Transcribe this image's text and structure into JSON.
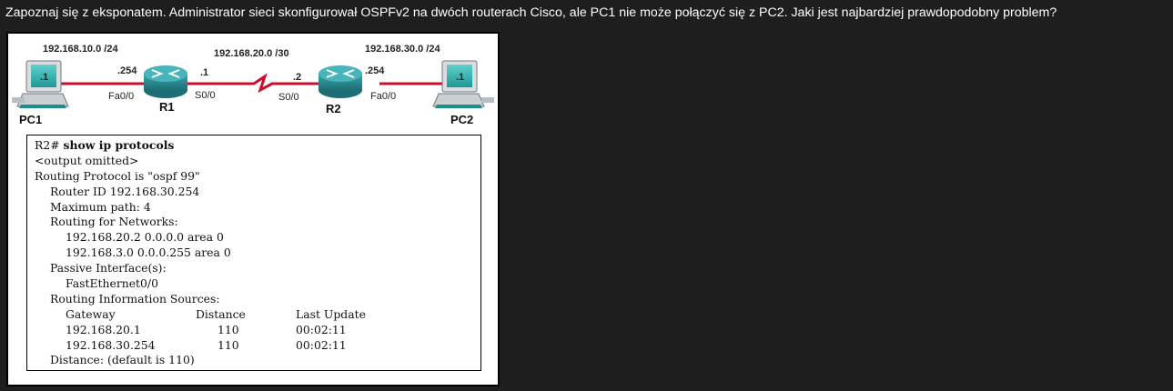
{
  "question": "Zapoznaj się z eksponatem. Administrator sieci skonfigurował OSPFv2 na dwóch routerach Cisco, ale PC1 nie może połączyć się z PC2. Jaki jest najbardziej prawdopodobny problem?",
  "topology": {
    "net_left": "192.168.10.0 /24",
    "net_mid": "192.168.20.0 /30",
    "net_right": "192.168.30.0 /24",
    "pc1_ip_label": ".1",
    "pc2_ip_label": ".1",
    "r1_fa_ip": ".254",
    "r1_s_ip": ".1",
    "r2_s_ip": ".2",
    "r2_fa_ip": ".254",
    "r1_fa_if": "Fa0/0",
    "r1_s_if": "S0/0",
    "r2_s_if": "S0/0",
    "r2_fa_if": "Fa0/0",
    "pc1": "PC1",
    "pc2": "PC2",
    "r1": "R1",
    "r2": "R2",
    "colors": {
      "router": "#2b8f95",
      "link": "#c8102e",
      "pc_screen": "#29a9a6"
    }
  },
  "terminal": {
    "prompt": "R2# ",
    "command": "show ip protocols",
    "lines": {
      "omitted": "<output omitted>",
      "proto": "Routing Protocol is \"ospf 99\"",
      "router_id": "Router ID 192.168.30.254",
      "max_path": "Maximum path: 4",
      "routing_for": "Routing for Networks:",
      "net1": "192.168.20.2 0.0.0.0 area 0",
      "net2": "192.168.3.0 0.0.0.255 area 0",
      "passive": "Passive Interface(s):",
      "passive_if": "FastEthernet0/0",
      "info_sources": "Routing Information Sources:",
      "distance_default": "Distance: (default is 110)"
    },
    "table": {
      "headers": [
        "Gateway",
        "Distance",
        "Last Update"
      ],
      "rows": [
        [
          "192.168.20.1",
          "110",
          "00:02:11"
        ],
        [
          "192.168.30.254",
          "110",
          "00:02:11"
        ]
      ]
    }
  }
}
